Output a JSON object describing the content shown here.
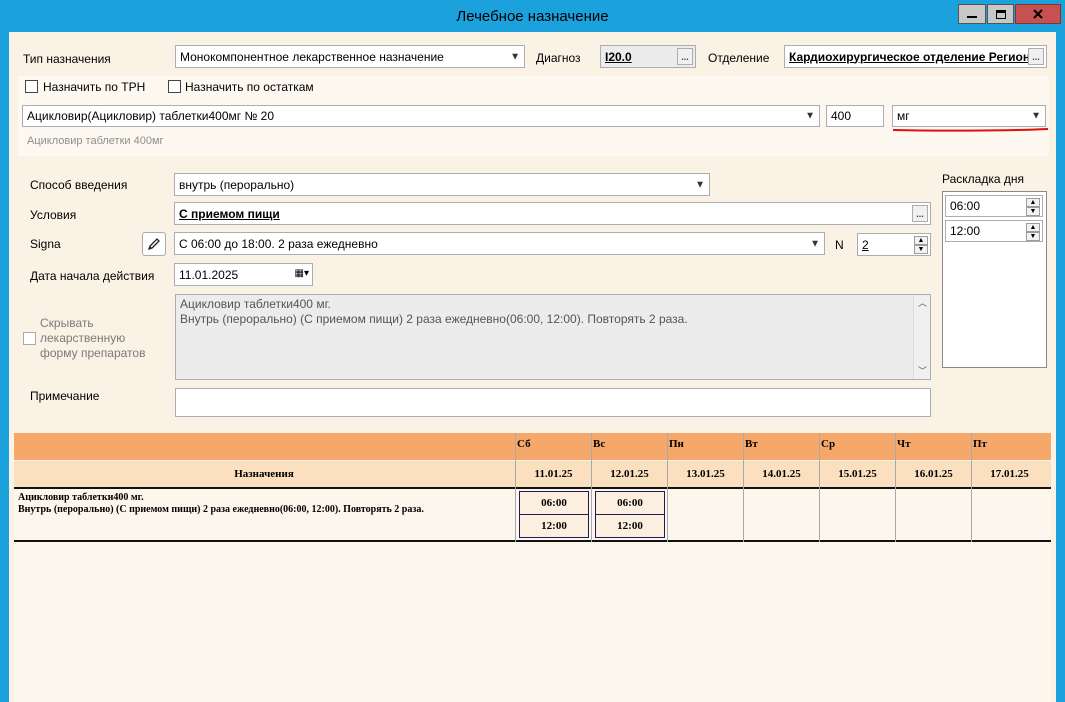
{
  "window": {
    "title": "Лечебное назначение"
  },
  "form": {
    "type_label": "Тип назначения",
    "type_value": "Монокомпонентное лекарственное назначение",
    "diagnosis_label": "Диагноз",
    "diagnosis_value": "I20.0",
    "department_label": "Отделение",
    "department_value": "Кардиохирургическое отделение Регион",
    "assign_trn_label": "Назначить по ТРН",
    "assign_remains_label": "Назначить по остаткам",
    "drug_value": "Ацикловир(Ацикловир) таблетки400мг № 20",
    "dose_value": "400",
    "unit_value": "мг",
    "drug_hint": "Ацикловир таблетки 400мг",
    "route_label": "Способ введения",
    "route_value": "внутрь (перорально)",
    "conditions_label": "Условия",
    "conditions_value": "С приемом пищи",
    "signa_label": "Signa",
    "signa_value": "С 06:00 до 18:00. 2 раза ежедневно",
    "n_label": "N",
    "n_value": "2",
    "start_date_label": "Дата начала действия",
    "start_date_value": "11.01.2025",
    "hide_form_label": "Скрывать лекарственную форму препаратов",
    "summary_line1": "Ацикловир таблетки400 мг.",
    "summary_line2": "Внутрь (перорально) (С приемом пищи) 2 раза ежедневно(06:00, 12:00). Повторять 2 раза.",
    "note_label": "Примечание",
    "note_value": ""
  },
  "raskladka": {
    "label": "Раскладка дня",
    "times": [
      "06:00",
      "12:00"
    ]
  },
  "grid": {
    "title_col": "Назначения",
    "days": [
      {
        "dow": "Сб",
        "date": "11.01.25"
      },
      {
        "dow": "Вс",
        "date": "12.01.25"
      },
      {
        "dow": "Пн",
        "date": "13.01.25"
      },
      {
        "dow": "Вт",
        "date": "14.01.25"
      },
      {
        "dow": "Ср",
        "date": "15.01.25"
      },
      {
        "dow": "Чт",
        "date": "16.01.25"
      },
      {
        "dow": "Пт",
        "date": "17.01.25"
      }
    ],
    "row": {
      "line1": "Ацикловир таблетки400 мг.",
      "line2": "Внутрь (перорально) (С приемом пищи) 2 раза ежедневно(06:00, 12:00). Повторять 2 раза.",
      "day1_times": [
        "06:00",
        "12:00"
      ],
      "day2_times": [
        "06:00",
        "12:00"
      ]
    }
  },
  "colors": {
    "titlebar": "#1ba1dc",
    "client_bg": "#fbf2e6",
    "grid_header": "#f6a86a",
    "grid_subheader": "#fbe0c0",
    "annotation_underline": "#e01010"
  }
}
